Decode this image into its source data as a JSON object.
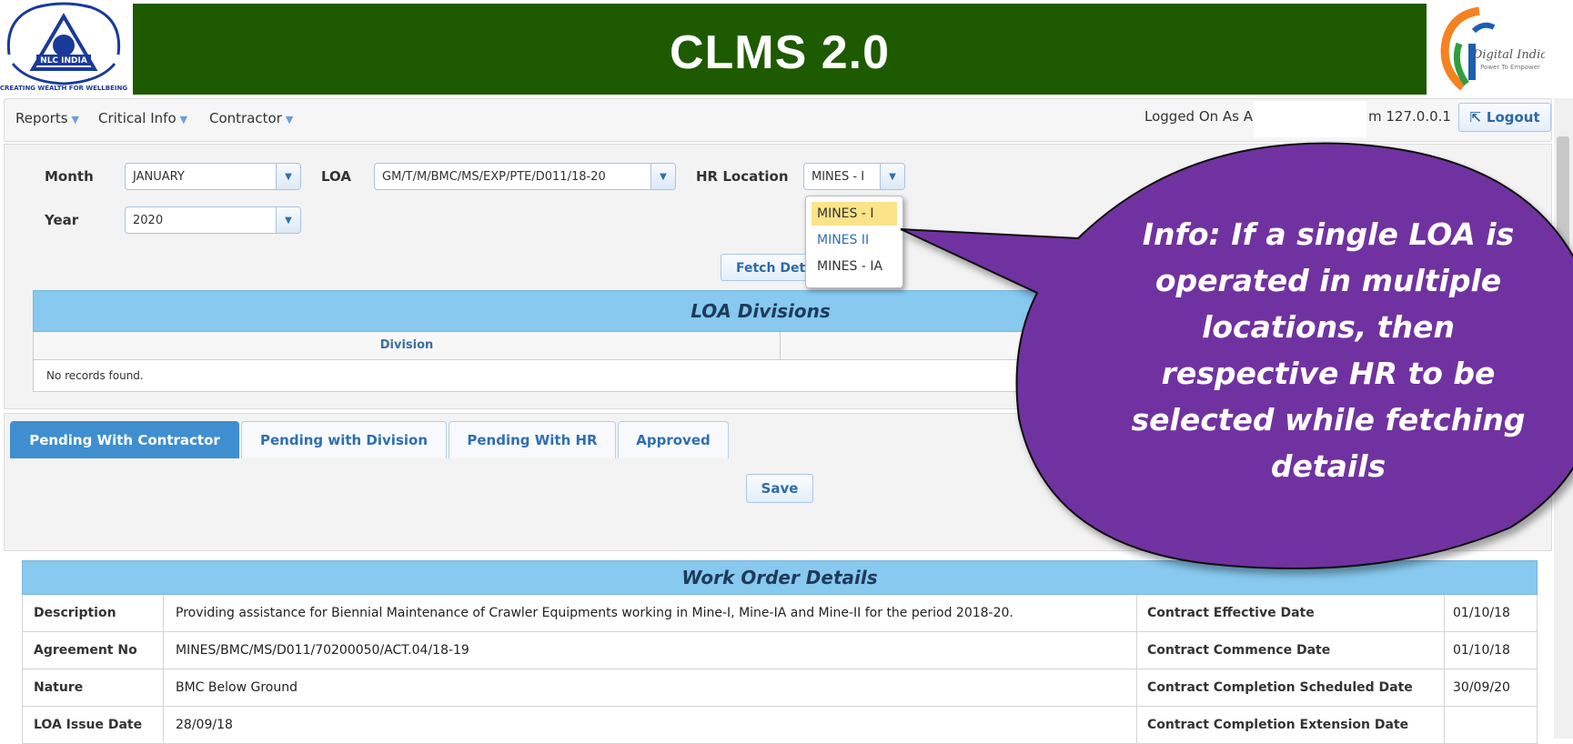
{
  "header": {
    "title": "CLMS 2.0",
    "left_logo_text": "NLC INDIA",
    "left_logo_tagline": "CREATING WEALTH FOR WELLBEING",
    "right_logo_text": "Digital India",
    "right_logo_tagline": "Power To Empower",
    "banner_color": "#1e5a00"
  },
  "menu": {
    "items": [
      {
        "label": "Reports"
      },
      {
        "label": "Critical Info"
      },
      {
        "label": "Contractor"
      }
    ],
    "logged_on": "Logged On As A",
    "from_ip": "m 127.0.0.1",
    "logout_label": "Logout"
  },
  "filters": {
    "month_label": "Month",
    "month_value": "JANUARY",
    "loa_label": "LOA",
    "loa_value": "GM/T/M/BMC/MS/EXP/PTE/D011/18-20",
    "hr_label": "HR Location",
    "hr_value": "MINES - I",
    "year_label": "Year",
    "year_value": "2020",
    "hr_options": [
      "MINES - I",
      "MINES II",
      "MINES - IA"
    ],
    "fetch_label": "Fetch Details"
  },
  "loa_divisions": {
    "title": "LOA Divisions",
    "column": "Division",
    "empty": "No records found."
  },
  "tabs": {
    "items": [
      {
        "label": "Pending With Contractor"
      },
      {
        "label": "Pending with Division"
      },
      {
        "label": "Pending With HR"
      },
      {
        "label": "Approved"
      }
    ],
    "save_label": "Save"
  },
  "work_order": {
    "title": "Work Order Details",
    "rows": [
      {
        "k1": "Description",
        "v1": "Providing assistance for Biennial Maintenance of Crawler Equipments working in Mine-I, Mine-IA and Mine-II for the period 2018-20.",
        "k2": "Contract Effective Date",
        "v2": "01/10/18"
      },
      {
        "k1": "Agreement No",
        "v1": "MINES/BMC/MS/D011/70200050/ACT.04/18-19",
        "k2": "Contract Commence Date",
        "v2": "01/10/18"
      },
      {
        "k1": "Nature",
        "v1": "BMC Below Ground",
        "k2": "Contract Completion Scheduled Date",
        "v2": "30/09/20"
      },
      {
        "k1": "LOA Issue Date",
        "v1": "28/09/18",
        "k2": "Contract Completion Extension Date",
        "v2": ""
      }
    ]
  },
  "callout": {
    "lines": [
      "Info: If a single  LOA is",
      "operated in multiple",
      "locations, then",
      "respective HR to be",
      "selected while fetching",
      "details"
    ],
    "color": "#7030a0"
  }
}
